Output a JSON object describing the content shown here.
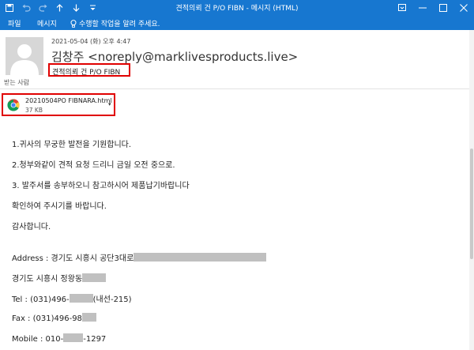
{
  "window": {
    "title": "견적의뢰 건 P/O FIBN  -  메시지 (HTML)"
  },
  "ribbon": {
    "tabs": [
      {
        "label": "파일"
      },
      {
        "label": "메시지"
      }
    ],
    "tell_me": "수행할 작업을 알려 주세요."
  },
  "header": {
    "datetime": "2021-05-04 (화) 오후 4:47",
    "sender": "김창주 <noreply@marklivesproducts.live>",
    "subject": "견적의뢰 건 P/O FIBN",
    "to_label": "받는 사람"
  },
  "attachment": {
    "name": "20210504PO FIBNARA.html",
    "size": "37 KB",
    "icon": "chrome-icon"
  },
  "body": {
    "line1": "1.귀사의 무궁한 발전을 기원합니다.",
    "line2": "2.청부와같이 견적 요청 드리니 금일 오전 중으로.",
    "line3": "3. 발주서를 송부하오니 참고하시어 제품납기바랍니다",
    "line4": "확인하여 주시기를 바랍니다.",
    "line5": "감사합니다.",
    "address_prefix": "Address : 경기도 시흥시 공단3대로",
    "address2_prefix": "경기도 시흥시 정왕동",
    "tel_prefix": "Tel : (031)496-",
    "tel_suffix": "(내선-215)",
    "fax_prefix": "Fax : (031)496-98",
    "mobile_prefix": "Mobile : 010-",
    "mobile_suffix": "-1297"
  },
  "colors": {
    "titlebar": "#1777d0",
    "highlight_border": "#e00000",
    "redaction": "#c0c0c0"
  }
}
